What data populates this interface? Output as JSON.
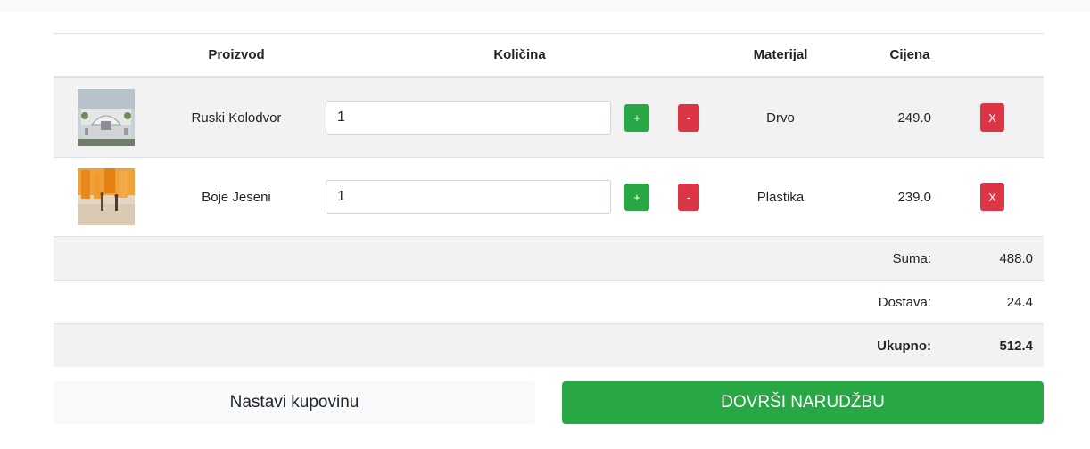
{
  "header": {
    "product": "Proizvod",
    "quantity": "Količina",
    "material": "Materijal",
    "price": "Cijena"
  },
  "items": [
    {
      "name": "Ruski Kolodvor",
      "quantity": "1",
      "material": "Drvo",
      "price": "249.0",
      "plus": "+",
      "minus": "-",
      "remove": "X"
    },
    {
      "name": "Boje Jeseni",
      "quantity": "1",
      "material": "Plastika",
      "price": "239.0",
      "plus": "+",
      "minus": "-",
      "remove": "X"
    }
  ],
  "summary": {
    "sum_label": "Suma:",
    "sum_value": "488.0",
    "shipping_label": "Dostava:",
    "shipping_value": "24.4",
    "total_label": "Ukupno:",
    "total_value": "512.4"
  },
  "actions": {
    "continue": "Nastavi kupovinu",
    "finish": "DOVRŠI NARUDŽBU"
  },
  "colors": {
    "success": "#28a745",
    "danger": "#dc3545",
    "stripe": "#f2f2f2",
    "light": "#f8f9fa"
  }
}
